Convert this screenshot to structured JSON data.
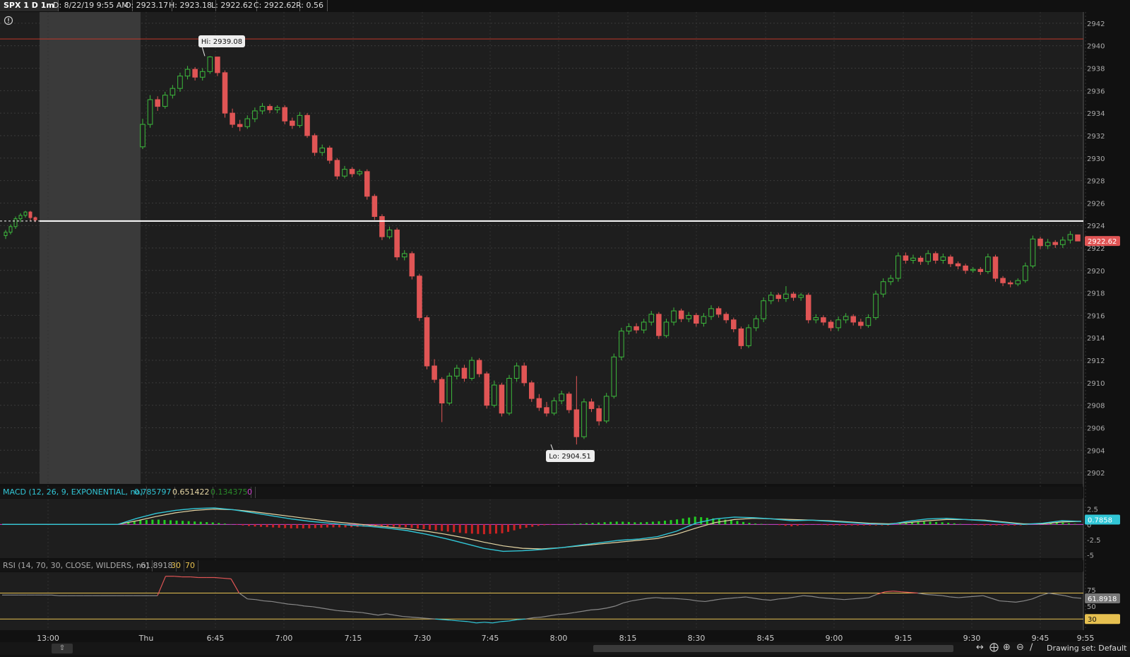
{
  "header": {
    "symbol": "SPX 1 D 1m",
    "date": "D: 8/22/19 9:55 AM",
    "open": "O: 2923.17",
    "high": "H: 2923.18",
    "low": "L: 2922.62",
    "close": "C: 2922.62",
    "range": "R: 0.56"
  },
  "annotations": {
    "hi": "Hi: 2939.08",
    "lo": "Lo: 2904.51",
    "last_price": "2922.62"
  },
  "macd": {
    "label": "MACD (12, 26, 9, EXPONENTIAL, no)",
    "value": "0.785797",
    "avg": "0.651422",
    "diff": "0.134375",
    "zero": "0",
    "badge": "0.7858"
  },
  "rsi": {
    "label": "RSI (14, 70, 30, CLOSE, WILDERS, no)",
    "value": "61.8918",
    "os": "30",
    "ob": "70",
    "badge": "61.8918",
    "badge_os": "30"
  },
  "footer": {
    "drawing_set": "Drawing set: Default"
  },
  "colors": {
    "up": "#3dbb3d",
    "down": "#e05555",
    "macd": "#31c6d6",
    "macd_avg": "#e6d7a5",
    "rsi": "#888888",
    "rsi_ob": "#e05555",
    "rsi_os": "#31c6d6",
    "bg": "#1e1e1e"
  },
  "chart_data": {
    "type": "candlestick",
    "y_ticks": [
      2902,
      2904,
      2906,
      2908,
      2910,
      2912,
      2914,
      2916,
      2918,
      2920,
      2922,
      2924,
      2926,
      2928,
      2930,
      2932,
      2934,
      2936,
      2938,
      2940,
      2942
    ],
    "ylim": [
      2901,
      2943
    ],
    "x_ticks": [
      "13:00",
      "Thu",
      "6:45",
      "7:00",
      "7:15",
      "7:30",
      "7:45",
      "8:00",
      "8:15",
      "8:30",
      "8:45",
      "9:00",
      "9:15",
      "9:30",
      "9:45",
      "9:55"
    ],
    "prev_close_line": 2924.4,
    "resistance_line": 2940.6,
    "candles_prev": [
      {
        "o": 2923.1,
        "c": 2923.4,
        "h": 2923.6,
        "l": 2922.8
      },
      {
        "o": 2923.4,
        "c": 2923.9,
        "h": 2924.1,
        "l": 2923.2
      },
      {
        "o": 2923.9,
        "c": 2924.6,
        "h": 2924.8,
        "l": 2923.7
      },
      {
        "o": 2924.6,
        "c": 2924.9,
        "h": 2925.1,
        "l": 2924.3
      },
      {
        "o": 2924.9,
        "c": 2925.2,
        "h": 2925.3,
        "l": 2924.7
      },
      {
        "o": 2925.2,
        "c": 2924.7,
        "h": 2925.3,
        "l": 2924.4
      },
      {
        "o": 2924.7,
        "c": 2924.5,
        "h": 2924.8,
        "l": 2924.3
      }
    ],
    "ohlc": [
      {
        "o": 2931.0,
        "c": 2933.0,
        "h": 2933.5,
        "l": 2930.8
      },
      {
        "o": 2933.0,
        "c": 2935.2,
        "h": 2935.6,
        "l": 2932.7
      },
      {
        "o": 2935.2,
        "c": 2934.6,
        "h": 2935.5,
        "l": 2934.2
      },
      {
        "o": 2934.6,
        "c": 2935.6,
        "h": 2935.9,
        "l": 2934.4
      },
      {
        "o": 2935.6,
        "c": 2936.2,
        "h": 2936.5,
        "l": 2935.3
      },
      {
        "o": 2936.2,
        "c": 2937.3,
        "h": 2937.6,
        "l": 2935.9
      },
      {
        "o": 2937.3,
        "c": 2937.9,
        "h": 2938.2,
        "l": 2937.0
      },
      {
        "o": 2937.9,
        "c": 2937.2,
        "h": 2938.1,
        "l": 2936.9
      },
      {
        "o": 2937.2,
        "c": 2937.7,
        "h": 2938.0,
        "l": 2936.9
      },
      {
        "o": 2937.7,
        "c": 2939.0,
        "h": 2939.08,
        "l": 2937.5
      },
      {
        "o": 2939.0,
        "c": 2937.6,
        "h": 2939.0,
        "l": 2937.3
      },
      {
        "o": 2937.6,
        "c": 2934.0,
        "h": 2937.8,
        "l": 2933.6
      },
      {
        "o": 2934.0,
        "c": 2933.0,
        "h": 2934.4,
        "l": 2932.7
      },
      {
        "o": 2933.0,
        "c": 2932.8,
        "h": 2933.4,
        "l": 2932.4
      },
      {
        "o": 2932.8,
        "c": 2933.5,
        "h": 2933.8,
        "l": 2932.6
      },
      {
        "o": 2933.5,
        "c": 2934.2,
        "h": 2934.5,
        "l": 2933.2
      },
      {
        "o": 2934.2,
        "c": 2934.6,
        "h": 2934.9,
        "l": 2933.9
      },
      {
        "o": 2934.6,
        "c": 2934.3,
        "h": 2934.8,
        "l": 2934.0
      },
      {
        "o": 2934.3,
        "c": 2934.5,
        "h": 2934.7,
        "l": 2934.0
      },
      {
        "o": 2934.5,
        "c": 2933.3,
        "h": 2934.7,
        "l": 2933.0
      },
      {
        "o": 2933.3,
        "c": 2932.9,
        "h": 2933.6,
        "l": 2932.6
      },
      {
        "o": 2932.9,
        "c": 2933.8,
        "h": 2934.1,
        "l": 2932.7
      },
      {
        "o": 2933.8,
        "c": 2932.0,
        "h": 2934.0,
        "l": 2931.8
      },
      {
        "o": 2932.0,
        "c": 2930.5,
        "h": 2932.2,
        "l": 2930.2
      },
      {
        "o": 2930.5,
        "c": 2930.9,
        "h": 2931.2,
        "l": 2930.2
      },
      {
        "o": 2930.9,
        "c": 2929.8,
        "h": 2931.1,
        "l": 2929.5
      },
      {
        "o": 2929.8,
        "c": 2928.4,
        "h": 2930.0,
        "l": 2928.1
      },
      {
        "o": 2928.4,
        "c": 2929.0,
        "h": 2929.3,
        "l": 2928.2
      },
      {
        "o": 2929.0,
        "c": 2928.6,
        "h": 2929.2,
        "l": 2928.3
      },
      {
        "o": 2928.6,
        "c": 2928.8,
        "h": 2929.0,
        "l": 2928.4
      },
      {
        "o": 2928.8,
        "c": 2926.6,
        "h": 2929.0,
        "l": 2926.3
      },
      {
        "o": 2926.6,
        "c": 2924.8,
        "h": 2926.8,
        "l": 2924.5
      },
      {
        "o": 2924.8,
        "c": 2923.0,
        "h": 2925.0,
        "l": 2922.7
      },
      {
        "o": 2923.0,
        "c": 2923.6,
        "h": 2923.9,
        "l": 2922.8
      },
      {
        "o": 2923.6,
        "c": 2921.2,
        "h": 2923.8,
        "l": 2920.9
      },
      {
        "o": 2921.2,
        "c": 2921.5,
        "h": 2921.8,
        "l": 2920.9
      },
      {
        "o": 2921.5,
        "c": 2919.5,
        "h": 2921.7,
        "l": 2919.2
      },
      {
        "o": 2919.5,
        "c": 2915.8,
        "h": 2919.7,
        "l": 2915.5
      },
      {
        "o": 2915.8,
        "c": 2911.5,
        "h": 2916.0,
        "l": 2911.2
      },
      {
        "o": 2911.5,
        "c": 2910.3,
        "h": 2912.1,
        "l": 2910.0
      },
      {
        "o": 2910.3,
        "c": 2908.2,
        "h": 2910.5,
        "l": 2906.5
      },
      {
        "o": 2908.2,
        "c": 2910.6,
        "h": 2910.9,
        "l": 2908.0
      },
      {
        "o": 2910.6,
        "c": 2911.3,
        "h": 2911.6,
        "l": 2910.3
      },
      {
        "o": 2911.3,
        "c": 2910.4,
        "h": 2911.6,
        "l": 2910.1
      },
      {
        "o": 2910.4,
        "c": 2912.0,
        "h": 2912.3,
        "l": 2910.2
      },
      {
        "o": 2912.0,
        "c": 2910.8,
        "h": 2912.2,
        "l": 2910.5
      },
      {
        "o": 2910.8,
        "c": 2908.0,
        "h": 2911.0,
        "l": 2907.7
      },
      {
        "o": 2908.0,
        "c": 2909.8,
        "h": 2910.2,
        "l": 2907.8
      },
      {
        "o": 2909.8,
        "c": 2907.3,
        "h": 2910.0,
        "l": 2907.0
      },
      {
        "o": 2907.3,
        "c": 2910.4,
        "h": 2910.7,
        "l": 2907.1
      },
      {
        "o": 2910.4,
        "c": 2911.5,
        "h": 2911.8,
        "l": 2910.1
      },
      {
        "o": 2911.5,
        "c": 2910.0,
        "h": 2911.8,
        "l": 2909.7
      },
      {
        "o": 2910.0,
        "c": 2908.6,
        "h": 2910.2,
        "l": 2908.3
      },
      {
        "o": 2908.6,
        "c": 2907.8,
        "h": 2909.0,
        "l": 2907.5
      },
      {
        "o": 2907.8,
        "c": 2907.3,
        "h": 2908.3,
        "l": 2907.0
      },
      {
        "o": 2907.3,
        "c": 2908.4,
        "h": 2908.7,
        "l": 2907.1
      },
      {
        "o": 2908.4,
        "c": 2909.0,
        "h": 2909.3,
        "l": 2908.1
      },
      {
        "o": 2909.0,
        "c": 2907.6,
        "h": 2909.2,
        "l": 2907.3
      },
      {
        "o": 2907.6,
        "c": 2905.2,
        "h": 2910.6,
        "l": 2904.51
      },
      {
        "o": 2905.2,
        "c": 2908.3,
        "h": 2908.6,
        "l": 2905.0
      },
      {
        "o": 2908.3,
        "c": 2907.7,
        "h": 2908.6,
        "l": 2907.4
      },
      {
        "o": 2907.7,
        "c": 2906.6,
        "h": 2908.0,
        "l": 2906.2
      },
      {
        "o": 2906.6,
        "c": 2908.8,
        "h": 2909.1,
        "l": 2906.4
      },
      {
        "o": 2908.8,
        "c": 2912.3,
        "h": 2912.6,
        "l": 2908.6
      },
      {
        "o": 2912.3,
        "c": 2914.6,
        "h": 2914.9,
        "l": 2912.0
      },
      {
        "o": 2914.6,
        "c": 2915.0,
        "h": 2915.3,
        "l": 2914.3
      },
      {
        "o": 2915.0,
        "c": 2914.7,
        "h": 2915.3,
        "l": 2914.4
      },
      {
        "o": 2914.7,
        "c": 2915.4,
        "h": 2915.7,
        "l": 2914.4
      },
      {
        "o": 2915.4,
        "c": 2916.1,
        "h": 2916.4,
        "l": 2915.1
      },
      {
        "o": 2916.1,
        "c": 2914.2,
        "h": 2916.3,
        "l": 2913.9
      },
      {
        "o": 2914.2,
        "c": 2915.4,
        "h": 2915.7,
        "l": 2914.0
      },
      {
        "o": 2915.4,
        "c": 2916.4,
        "h": 2916.7,
        "l": 2915.1
      },
      {
        "o": 2916.4,
        "c": 2915.7,
        "h": 2916.6,
        "l": 2915.4
      },
      {
        "o": 2915.7,
        "c": 2916.0,
        "h": 2916.3,
        "l": 2915.4
      },
      {
        "o": 2916.0,
        "c": 2915.3,
        "h": 2916.2,
        "l": 2915.0
      },
      {
        "o": 2915.3,
        "c": 2915.9,
        "h": 2916.2,
        "l": 2915.0
      },
      {
        "o": 2915.9,
        "c": 2916.6,
        "h": 2916.9,
        "l": 2915.6
      },
      {
        "o": 2916.6,
        "c": 2916.1,
        "h": 2916.8,
        "l": 2915.8
      },
      {
        "o": 2916.1,
        "c": 2915.6,
        "h": 2916.3,
        "l": 2915.3
      },
      {
        "o": 2915.6,
        "c": 2914.8,
        "h": 2915.8,
        "l": 2914.5
      },
      {
        "o": 2914.8,
        "c": 2913.3,
        "h": 2915.0,
        "l": 2913.0
      },
      {
        "o": 2913.3,
        "c": 2914.9,
        "h": 2915.2,
        "l": 2913.1
      },
      {
        "o": 2914.9,
        "c": 2915.7,
        "h": 2916.0,
        "l": 2914.6
      },
      {
        "o": 2915.7,
        "c": 2917.3,
        "h": 2917.6,
        "l": 2915.4
      },
      {
        "o": 2917.3,
        "c": 2917.8,
        "h": 2918.1,
        "l": 2917.0
      },
      {
        "o": 2917.8,
        "c": 2917.5,
        "h": 2918.0,
        "l": 2917.2
      },
      {
        "o": 2917.5,
        "c": 2917.9,
        "h": 2918.6,
        "l": 2917.2
      },
      {
        "o": 2917.9,
        "c": 2917.6,
        "h": 2918.1,
        "l": 2917.3
      },
      {
        "o": 2917.6,
        "c": 2917.8,
        "h": 2918.0,
        "l": 2917.3
      },
      {
        "o": 2917.8,
        "c": 2915.6,
        "h": 2918.0,
        "l": 2915.3
      },
      {
        "o": 2915.6,
        "c": 2915.8,
        "h": 2916.1,
        "l": 2915.3
      },
      {
        "o": 2915.8,
        "c": 2915.4,
        "h": 2916.0,
        "l": 2915.1
      },
      {
        "o": 2915.4,
        "c": 2914.9,
        "h": 2915.6,
        "l": 2914.6
      },
      {
        "o": 2914.9,
        "c": 2915.6,
        "h": 2915.9,
        "l": 2914.6
      },
      {
        "o": 2915.6,
        "c": 2915.9,
        "h": 2916.2,
        "l": 2915.3
      },
      {
        "o": 2915.9,
        "c": 2915.4,
        "h": 2916.1,
        "l": 2915.1
      },
      {
        "o": 2915.4,
        "c": 2915.1,
        "h": 2915.7,
        "l": 2914.8
      },
      {
        "o": 2915.1,
        "c": 2915.8,
        "h": 2916.1,
        "l": 2914.9
      },
      {
        "o": 2915.8,
        "c": 2917.9,
        "h": 2918.2,
        "l": 2915.6
      },
      {
        "o": 2917.9,
        "c": 2919.0,
        "h": 2919.3,
        "l": 2917.6
      },
      {
        "o": 2919.0,
        "c": 2919.3,
        "h": 2919.6,
        "l": 2918.7
      },
      {
        "o": 2919.3,
        "c": 2921.3,
        "h": 2921.6,
        "l": 2919.0
      },
      {
        "o": 2921.3,
        "c": 2920.9,
        "h": 2921.6,
        "l": 2920.6
      },
      {
        "o": 2920.9,
        "c": 2921.1,
        "h": 2921.4,
        "l": 2920.6
      },
      {
        "o": 2921.1,
        "c": 2920.8,
        "h": 2921.3,
        "l": 2920.5
      },
      {
        "o": 2920.8,
        "c": 2921.5,
        "h": 2921.8,
        "l": 2920.5
      },
      {
        "o": 2921.5,
        "c": 2920.9,
        "h": 2921.7,
        "l": 2920.6
      },
      {
        "o": 2920.9,
        "c": 2921.2,
        "h": 2921.5,
        "l": 2920.6
      },
      {
        "o": 2921.2,
        "c": 2920.6,
        "h": 2921.4,
        "l": 2920.3
      },
      {
        "o": 2920.6,
        "c": 2920.4,
        "h": 2920.8,
        "l": 2920.1
      },
      {
        "o": 2920.4,
        "c": 2920.0,
        "h": 2920.6,
        "l": 2919.7
      },
      {
        "o": 2920.0,
        "c": 2920.1,
        "h": 2920.3,
        "l": 2919.8
      },
      {
        "o": 2920.1,
        "c": 2919.9,
        "h": 2920.3,
        "l": 2919.6
      },
      {
        "o": 2919.9,
        "c": 2921.2,
        "h": 2921.5,
        "l": 2919.7
      },
      {
        "o": 2921.2,
        "c": 2919.3,
        "h": 2921.4,
        "l": 2919.0
      },
      {
        "o": 2919.3,
        "c": 2918.9,
        "h": 2919.5,
        "l": 2918.6
      },
      {
        "o": 2918.9,
        "c": 2918.8,
        "h": 2919.1,
        "l": 2918.5
      },
      {
        "o": 2918.8,
        "c": 2919.1,
        "h": 2919.3,
        "l": 2918.6
      },
      {
        "o": 2919.1,
        "c": 2920.4,
        "h": 2920.7,
        "l": 2918.9
      },
      {
        "o": 2920.4,
        "c": 2922.8,
        "h": 2923.1,
        "l": 2920.2
      },
      {
        "o": 2922.8,
        "c": 2922.2,
        "h": 2923.0,
        "l": 2921.9
      },
      {
        "o": 2922.2,
        "c": 2922.5,
        "h": 2922.8,
        "l": 2921.9
      },
      {
        "o": 2922.5,
        "c": 2922.3,
        "h": 2922.7,
        "l": 2922.0
      },
      {
        "o": 2922.3,
        "c": 2922.7,
        "h": 2923.0,
        "l": 2922.0
      },
      {
        "o": 2922.7,
        "c": 2923.2,
        "h": 2923.5,
        "l": 2922.4
      },
      {
        "o": 2923.17,
        "c": 2922.62,
        "h": 2923.18,
        "l": 2922.62
      }
    ],
    "macd_yticks": [
      "2.5",
      "0",
      "-2.5",
      "-5"
    ],
    "macd_ylim": [
      -5.5,
      3.5
    ],
    "macd_value": [
      0,
      0,
      0,
      0,
      0,
      0,
      0,
      1.0,
      1.8,
      2.3,
      2.6,
      2.7,
      2.4,
      1.9,
      1.4,
      0.9,
      0.5,
      0.2,
      -0.1,
      -0.3,
      -0.6,
      -1.0,
      -1.6,
      -2.3,
      -3.1,
      -3.9,
      -4.4,
      -4.3,
      -4.1,
      -3.8,
      -3.4,
      -3.0,
      -2.6,
      -2.4,
      -2.0,
      -1.1,
      0.2,
      0.9,
      1.2,
      1.1,
      0.9,
      0.6,
      0.7,
      0.5,
      0.3,
      0.1,
      0.0,
      0.5,
      0.9,
      1.0,
      0.8,
      0.6,
      0.3,
      0.0,
      0.2,
      0.6,
      0.5
    ],
    "macd_avg": [
      0,
      0,
      0,
      0,
      0,
      0,
      0,
      0.6,
      1.3,
      1.9,
      2.3,
      2.5,
      2.4,
      2.1,
      1.7,
      1.3,
      0.9,
      0.5,
      0.2,
      -0.1,
      -0.4,
      -0.7,
      -1.1,
      -1.6,
      -2.2,
      -2.9,
      -3.5,
      -3.9,
      -4.0,
      -3.8,
      -3.5,
      -3.2,
      -2.9,
      -2.6,
      -2.3,
      -1.6,
      -0.6,
      0.3,
      0.8,
      1.0,
      0.9,
      0.8,
      0.7,
      0.6,
      0.4,
      0.2,
      0.1,
      0.3,
      0.6,
      0.8,
      0.8,
      0.7,
      0.4,
      0.1,
      0.1,
      0.4,
      0.5
    ],
    "rsi_levels": [
      30,
      70
    ],
    "rsi_ylim": [
      15,
      100
    ],
    "rsi": [
      67,
      67,
      67,
      67,
      67,
      67,
      67,
      66,
      66,
      66,
      66,
      66,
      66,
      66,
      66,
      66,
      66,
      66,
      66,
      66,
      96,
      96,
      95,
      95,
      94,
      94,
      94,
      93,
      92,
      70,
      61,
      60,
      58,
      57,
      55,
      53,
      52,
      50,
      49,
      47,
      45,
      43,
      42,
      41,
      40,
      38,
      36,
      38,
      36,
      34,
      33,
      32,
      31,
      30,
      29,
      28,
      27,
      26,
      24,
      25,
      24,
      26,
      27,
      29,
      30,
      32,
      33,
      35,
      37,
      38,
      40,
      42,
      44,
      45,
      47,
      50,
      55,
      58,
      60,
      62,
      63,
      62,
      62,
      61,
      60,
      58,
      57,
      59,
      61,
      62,
      63,
      64,
      62,
      60,
      59,
      61,
      62,
      64,
      66,
      65,
      63,
      62,
      61,
      60,
      61,
      62,
      63,
      68,
      72,
      73,
      72,
      71,
      70,
      68,
      67,
      66,
      64,
      63,
      64,
      65,
      66,
      62,
      58,
      57,
      56,
      58,
      61,
      66,
      70,
      68,
      66,
      63,
      62
    ]
  }
}
